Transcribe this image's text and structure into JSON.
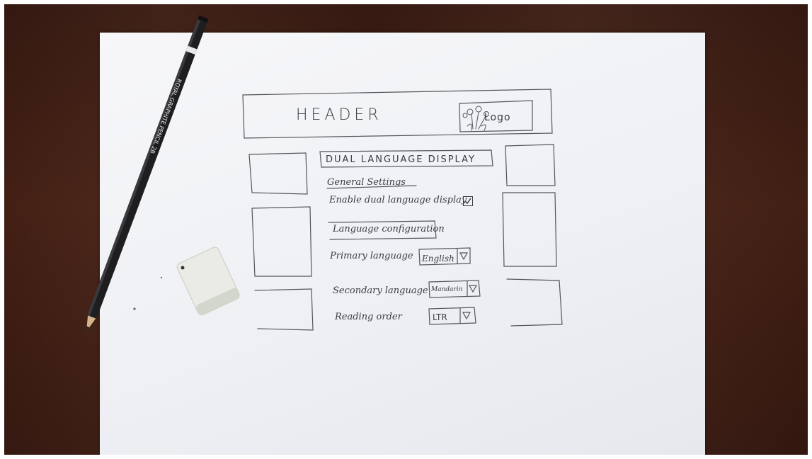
{
  "header": {
    "title": "HEADER",
    "logo_label": "Logo"
  },
  "main": {
    "title": "DUAL LANGUAGE DISPLAY",
    "general_settings": {
      "heading": "General Settings",
      "enable_label": "Enable dual language display",
      "enabled": true
    },
    "language_configuration": {
      "heading": "Language configuration",
      "primary": {
        "label": "Primary language",
        "value": "English"
      },
      "secondary": {
        "label": "Secondary language",
        "value": "Mandarin"
      },
      "reading_order": {
        "label": "Reading order",
        "value": "LTR"
      }
    }
  },
  "pencil": {
    "imprint": "ROYAL GRAPHITE PENCIL 2B"
  },
  "icons": [
    "logo-flower-icon",
    "checkbox-checked-icon",
    "dropdown-triangle-icon"
  ],
  "colors": {
    "table": "#3f1d13",
    "paper": "#f1f2f5",
    "pencil_line": "#3c3c42"
  }
}
